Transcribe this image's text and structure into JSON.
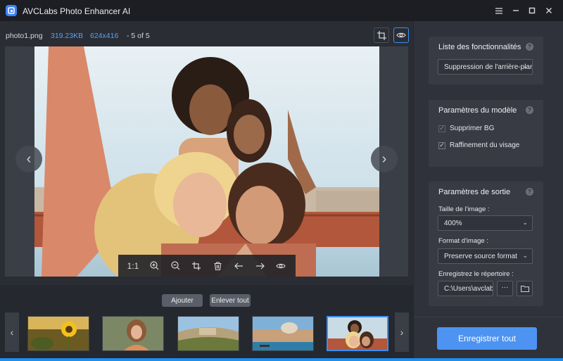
{
  "app": {
    "title": "AVCLabs Photo Enhancer AI"
  },
  "window": {
    "menu_icon": "menu-icon",
    "minimize_icon": "minimize-icon",
    "maximize_icon": "maximize-icon",
    "close_icon": "close-icon"
  },
  "file": {
    "name": "photo1.png",
    "size": "319.23KB",
    "dimensions": "624x416",
    "position": "- 5 of 5"
  },
  "toolbar": {
    "zoom_ratio": "1:1"
  },
  "strip": {
    "add_label": "Ajouter",
    "remove_all_label": "Enlever tout"
  },
  "thumbnails": [
    {
      "subject": "sunflower"
    },
    {
      "subject": "woman portrait"
    },
    {
      "subject": "hillside town"
    },
    {
      "subject": "venice canal"
    },
    {
      "subject": "group selfie",
      "selected": true
    }
  ],
  "features": {
    "title": "Liste des fonctionnalités",
    "selected": "Suppression de l'arrière-plan"
  },
  "model": {
    "title": "Paramètres du modèle",
    "options": [
      {
        "label": "Supprimer BG",
        "checked": true
      },
      {
        "label": "Raffinement du visage",
        "checked": true
      }
    ]
  },
  "output": {
    "title": "Paramètres de sortie",
    "size_label": "Taille de l'image :",
    "size_value": "400%",
    "format_label": "Format d'image :",
    "format_value": "Preserve source format",
    "dir_label": "Enregistrez le répertoire :",
    "dir_value": "C:\\Users\\avclabs",
    "more_label": "···"
  },
  "actions": {
    "save_all": "Enregistrer tout"
  },
  "colors": {
    "accent": "#4d93f2",
    "info": "#5aa0f0",
    "selected_border": "#3b8ef3"
  }
}
